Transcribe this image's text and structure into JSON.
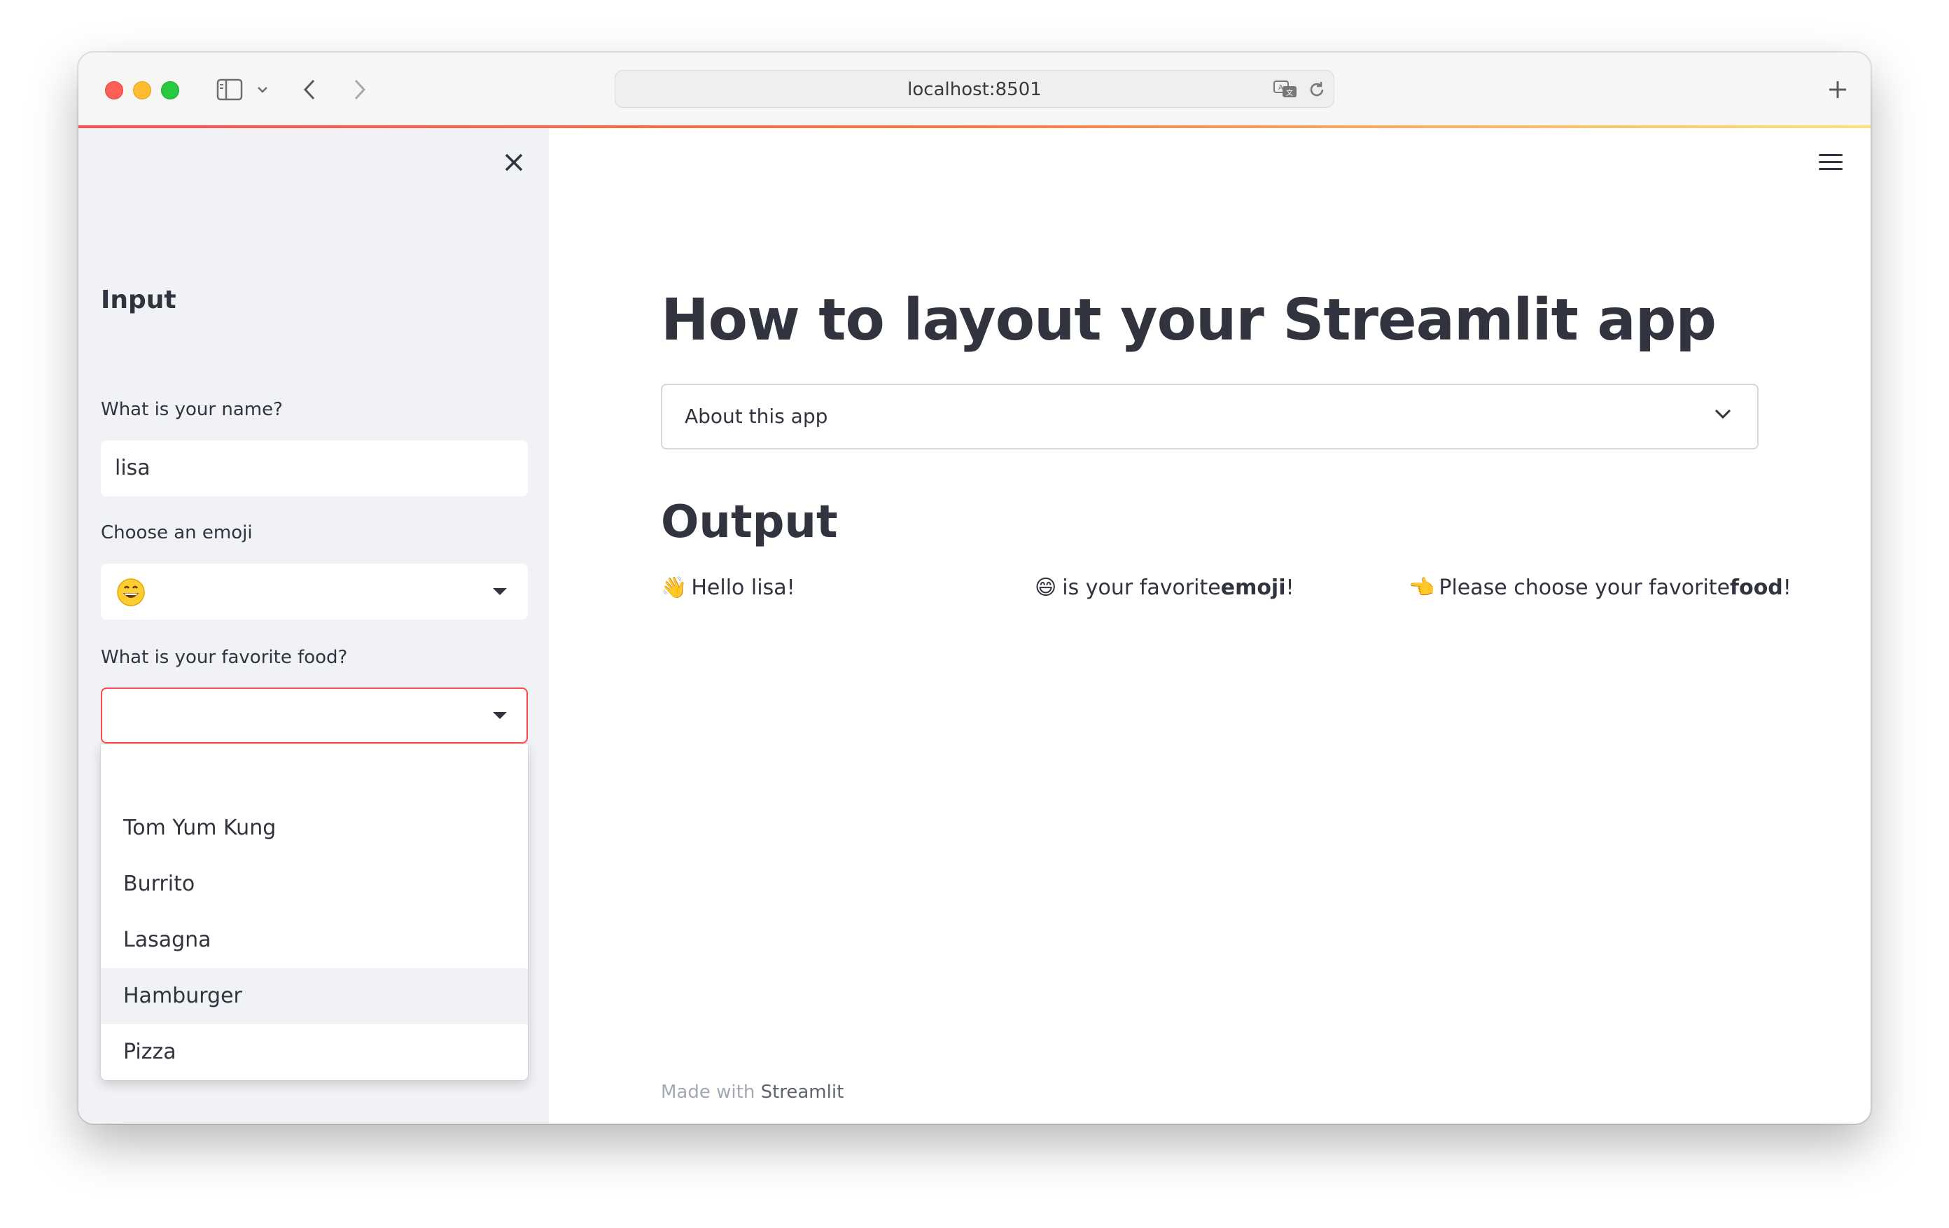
{
  "browser": {
    "url": "localhost:8501",
    "icons": [
      "sidebar-toggle-icon",
      "chevron-down-icon",
      "back-icon",
      "forward-icon",
      "translate-icon",
      "reload-icon",
      "new-tab-icon"
    ]
  },
  "sidebar": {
    "heading": "Input",
    "name_label": "What is your name?",
    "name_value": "lisa",
    "emoji_label": "Choose an emoji",
    "emoji_value": "😄",
    "food_label": "What is your favorite food?",
    "food_value": "",
    "food_options": [
      "",
      "Tom Yum Kung",
      "Burrito",
      "Lasagna",
      "Hamburger",
      "Pizza"
    ],
    "hovered_option": "Hamburger"
  },
  "main": {
    "title": "How to layout your Streamlit app",
    "expander_label": "About this app",
    "output_heading": "Output",
    "hello": {
      "emoji": "👋",
      "text": "Hello lisa!"
    },
    "emoji_out": {
      "emoji": "😄",
      "prefix": "is your favorite ",
      "bold": "emoji",
      "suffix": "!"
    },
    "food_out": {
      "emoji": "👈",
      "prefix": "Please choose your favorite ",
      "bold": "food",
      "suffix": "!"
    }
  },
  "footer": {
    "prefix": "Made with ",
    "brand": "Streamlit"
  },
  "colors": {
    "accent": "#ff4b4b",
    "sidebar_bg": "#f0f2f6",
    "text": "#31333f"
  }
}
